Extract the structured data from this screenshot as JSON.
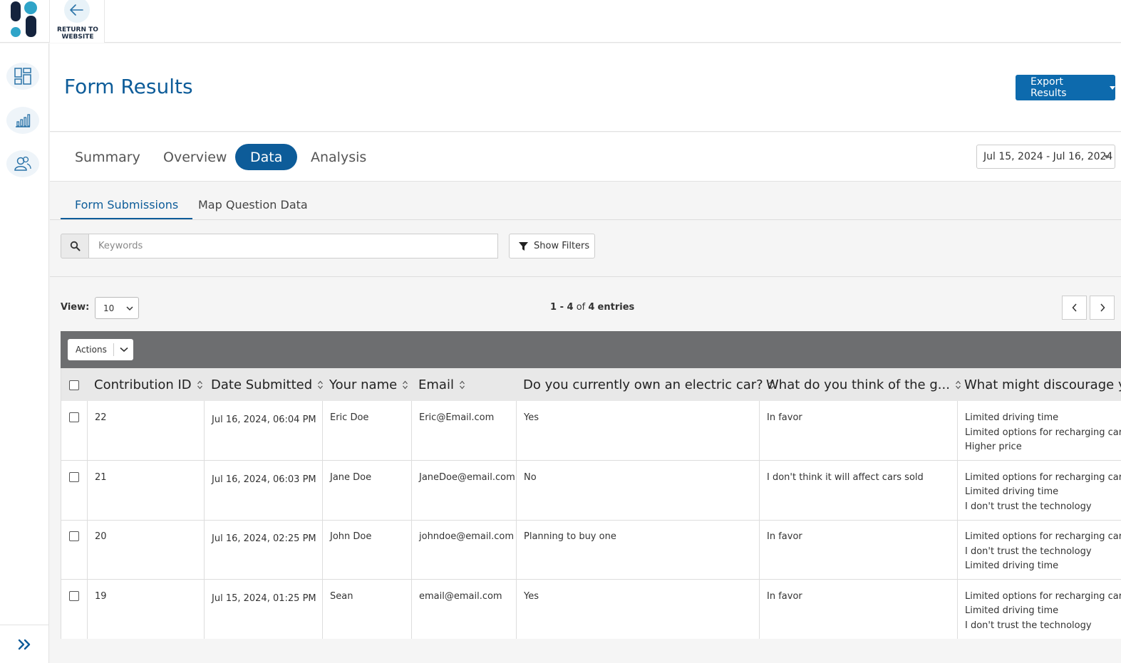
{
  "topbar": {
    "return_label_1": "RETURN TO",
    "return_label_2": "WEBSITE"
  },
  "header": {
    "title": "Form Results",
    "export_label": "Export Results"
  },
  "tabs": [
    "Summary",
    "Overview",
    "Data",
    "Analysis"
  ],
  "active_tab": "Data",
  "date_range": "Jul 15, 2024 - Jul 16, 2024",
  "subtabs": [
    "Form Submissions",
    "Map Question Data"
  ],
  "search": {
    "placeholder": "Keywords",
    "filters_label": "Show Filters"
  },
  "view": {
    "label": "View:",
    "value": "10"
  },
  "entries": {
    "start": "1",
    "end": "4",
    "of": "of",
    "total": "4",
    "suffix": "entries"
  },
  "actions_label": "Actions",
  "columns": [
    "Contribution ID",
    "Date Submitted",
    "Your name",
    "Email",
    "Do you currently own an electric car?",
    "What do you think of the g...",
    "What might discourage yo"
  ],
  "rows": [
    {
      "id": "22",
      "date": "Jul 16, 2024, 06:04 PM",
      "name": "Eric Doe",
      "email": "Eric@Email.com",
      "own": "Yes",
      "think": "In favor",
      "discourage": [
        "Limited driving time",
        "Limited options for recharging car",
        "Higher price"
      ]
    },
    {
      "id": "21",
      "date": "Jul 16, 2024, 06:03 PM",
      "name": "Jane Doe",
      "email": "JaneDoe@email.com",
      "own": "No",
      "think": "I don't think it will affect cars sold",
      "discourage": [
        "Limited options for recharging car",
        "Limited driving time",
        "I don't trust the technology"
      ]
    },
    {
      "id": "20",
      "date": "Jul 16, 2024, 02:25 PM",
      "name": "John Doe",
      "email": "johndoe@email.com",
      "own": "Planning to buy one",
      "think": "In favor",
      "discourage": [
        "Limited options for recharging car",
        "I don't trust the technology",
        "Limited driving time"
      ]
    },
    {
      "id": "19",
      "date": "Jul 15, 2024, 01:25 PM",
      "name": "Sean",
      "email": "email@email.com",
      "own": "Yes",
      "think": "In favor",
      "discourage": [
        "Limited options for recharging car",
        "Limited driving time",
        "I don't trust the technology"
      ]
    }
  ],
  "colors": {
    "brand_blue": "#0d5c99",
    "button_blue": "#0d6aad",
    "actions_bar": "#6d6e70",
    "logo_teal": "#2fa4c8",
    "logo_navy": "#14233d"
  }
}
